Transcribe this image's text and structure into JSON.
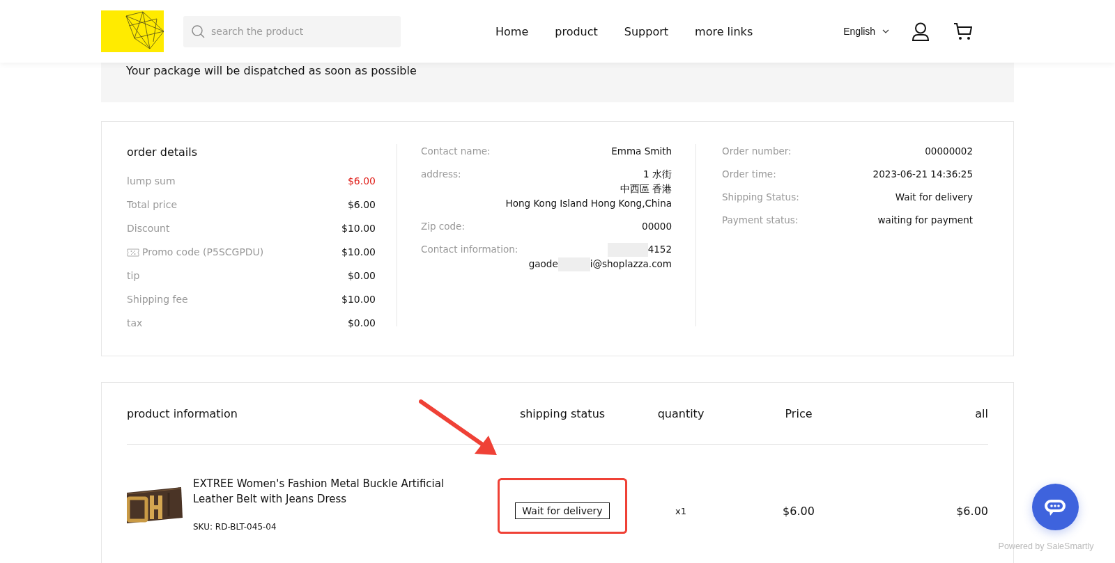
{
  "header": {
    "search": {
      "placeholder": "search the product"
    },
    "nav": [
      {
        "label": "Home"
      },
      {
        "label": "product"
      },
      {
        "label": "Support"
      },
      {
        "label": "more links"
      }
    ],
    "language": "English"
  },
  "notice": {
    "text": "Your package will be dispatched as soon as possible"
  },
  "order_details": {
    "title": "order details",
    "rows": [
      {
        "label": "lump sum",
        "value": "$6.00",
        "highlighted": true,
        "kind": "plain"
      },
      {
        "label": "Total price",
        "value": "$6.00",
        "highlighted": false,
        "kind": "plain"
      },
      {
        "label": "Discount",
        "value": "$10.00",
        "highlighted": false,
        "kind": "plain"
      },
      {
        "label": "Promo code (P5SCGPDU)",
        "value": "$10.00",
        "highlighted": false,
        "kind": "promo"
      },
      {
        "label": "tip",
        "value": "$0.00",
        "highlighted": false,
        "kind": "plain"
      },
      {
        "label": "Shipping fee",
        "value": "$10.00",
        "highlighted": false,
        "kind": "plain"
      },
      {
        "label": "tax",
        "value": "$0.00",
        "highlighted": false,
        "kind": "plain"
      }
    ]
  },
  "contact": {
    "rows": [
      {
        "label": "Contact name:",
        "lines": [
          "Emma Smith"
        ]
      },
      {
        "label": "address:",
        "lines": [
          "1 水街",
          "中西區 香港",
          "Hong Kong Island Hong Kong,China"
        ]
      },
      {
        "label": "Zip code:",
        "lines": [
          "00000"
        ]
      },
      {
        "label": "Contact information:",
        "lines": [
          {
            "after": "4152"
          },
          {
            "before": "gaode",
            "after": "i@shoplazza.com"
          }
        ]
      }
    ]
  },
  "order_info": {
    "rows": [
      {
        "label": "Order number:",
        "value": "00000002"
      },
      {
        "label": "Order time:",
        "value": "2023-06-21 14:36:25"
      },
      {
        "label": "Shipping Status:",
        "value": "Wait for delivery"
      },
      {
        "label": "Payment status:",
        "value": "waiting for payment"
      }
    ]
  },
  "products": {
    "columns": [
      "product information",
      "shipping status",
      "quantity",
      "Price",
      "all"
    ],
    "items": [
      {
        "name": "EXTREE Women's Fashion Metal Buckle Artificial Leather Belt with Jeans Dress",
        "sku": "SKU: RD-BLT-045-04",
        "shipping_status": "Wait for delivery",
        "quantity": "x1",
        "price": "$6.00",
        "total": "$6.00"
      }
    ]
  },
  "chat": {
    "powered_by": "Powered by SaleSmartly"
  }
}
